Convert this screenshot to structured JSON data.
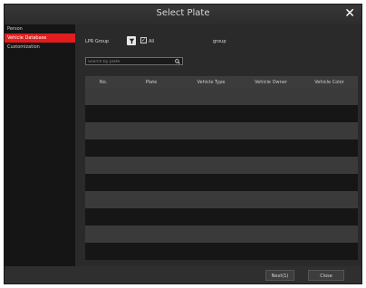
{
  "dialog": {
    "title": "Select Plate",
    "close_label": "✕"
  },
  "sidebar": {
    "items": [
      {
        "label": "Person"
      },
      {
        "label": "Vehicle Database"
      },
      {
        "label": "Customization"
      }
    ],
    "active_index": 1
  },
  "toolbar": {
    "lpr_label": "LPR Group",
    "all_label": "All",
    "group_label": "group"
  },
  "search": {
    "placeholder": "Search by plate"
  },
  "table": {
    "columns": [
      "No.",
      "Plate",
      "Vehicle Type",
      "Vehicle Owner",
      "Vehicle Color"
    ],
    "row_count": 10
  },
  "scrollbar": {
    "left_arrow": "◂",
    "right_arrow": "▸"
  },
  "footer": {
    "ok_label": "Next(1)",
    "close_label": "Close"
  },
  "colors": {
    "accent": "#e31d1d",
    "background": "#2a2a2a"
  },
  "icons": [
    "close-icon",
    "filter-icon",
    "search-icon",
    "scroll-left-icon",
    "scroll-right-icon"
  ]
}
